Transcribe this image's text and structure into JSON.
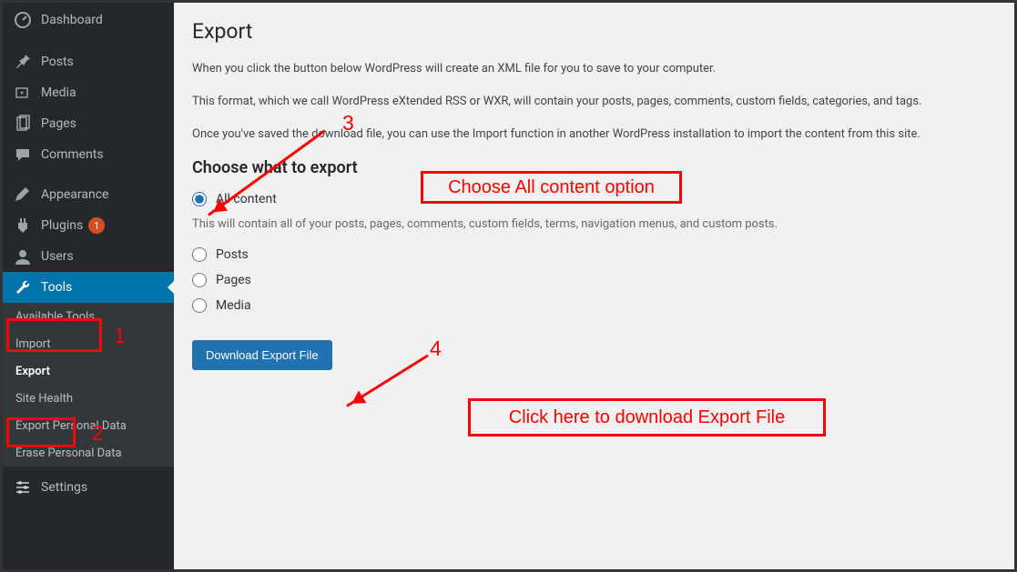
{
  "sidebar": {
    "items": [
      {
        "label": "Dashboard"
      },
      {
        "label": "Posts"
      },
      {
        "label": "Media"
      },
      {
        "label": "Pages"
      },
      {
        "label": "Comments"
      },
      {
        "label": "Appearance"
      },
      {
        "label": "Plugins",
        "badge": "1"
      },
      {
        "label": "Users"
      },
      {
        "label": "Tools"
      },
      {
        "label": "Settings"
      }
    ],
    "tools_sub": [
      {
        "label": "Available Tools"
      },
      {
        "label": "Import"
      },
      {
        "label": "Export"
      },
      {
        "label": "Site Health"
      },
      {
        "label": "Export Personal Data"
      },
      {
        "label": "Erase Personal Data"
      }
    ]
  },
  "main": {
    "title": "Export",
    "p1": "When you click the button below WordPress will create an XML file for you to save to your computer.",
    "p2": "This format, which we call WordPress eXtended RSS or WXR, will contain your posts, pages, comments, custom fields, categories, and tags.",
    "p3": "Once you've saved the download file, you can use the Import function in another WordPress installation to import the content from this site.",
    "choose_heading": "Choose what to export",
    "opt_all": "All content",
    "opt_all_desc": "This will contain all of your posts, pages, comments, custom fields, terms, navigation menus, and custom posts.",
    "opt_posts": "Posts",
    "opt_pages": "Pages",
    "opt_media": "Media",
    "download_btn": "Download Export File"
  },
  "annotations": {
    "n1": "1",
    "n2": "2",
    "n3": "3",
    "n4": "4",
    "box1_text": "Choose All content option",
    "box2_text": "Click here to download Export File"
  }
}
